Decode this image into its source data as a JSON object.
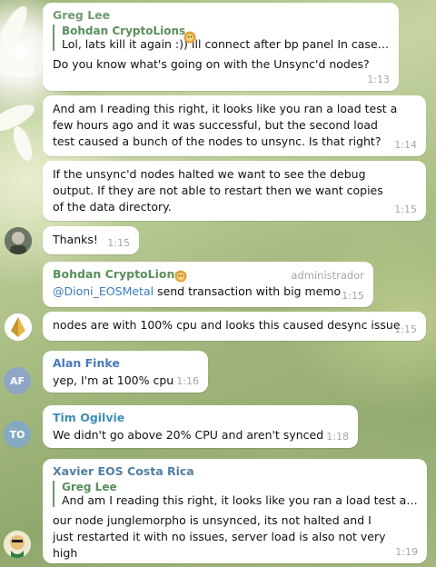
{
  "messages": [
    {
      "author": "Greg Lee",
      "quote_author": "Bohdan CryptoLions",
      "quote_text": "Lol, lats kill it again :)) Ill connect after bp panel In case it ...",
      "text": "Do you know what's going on with the Unsync'd nodes?",
      "time": "1:13"
    },
    {
      "text": "And am I reading this right, it looks like you ran a load test a few hours ago and it was successful, but the second load test caused a bunch of the nodes to unsync.  Is that right?",
      "time": "1:14"
    },
    {
      "text": "If the unsync'd nodes halted we want to see the debug output.  If they are not able to restart then we want copies of the data directory.",
      "time": "1:15"
    },
    {
      "text": "Thanks!",
      "time": "1:15"
    },
    {
      "author": "Bohdan CryptoLions",
      "badge": "administrador",
      "mention": "@Dioni_EOSMetal",
      "text": " send transaction with big memo",
      "time": "1:15"
    },
    {
      "text": "nodes are with 100% cpu and looks this caused desync issue",
      "time": "1:15"
    },
    {
      "author": "Alan Finke",
      "avatar": "AF",
      "text": "yep, I'm at 100% cpu",
      "time": "1:16"
    },
    {
      "author": "Tim Ogilvie",
      "avatar": "TO",
      "text": "We didn't go above 20% CPU and aren't synced",
      "time": "1:18"
    },
    {
      "author": "Xavier EOS Costa Rica",
      "quote_author": "Greg Lee",
      "quote_text": "And am I reading this right, it looks like you ran a load test a fe...",
      "text": "our node junglemorpho is unsynced, its not halted and I just restarted it with no issues, server load is also not very high",
      "time": "1:19"
    }
  ],
  "colors": {
    "greg": "#6f9c6f",
    "bohdan": "#5a8f5b",
    "alan": "#4a79b8",
    "tim": "#3f8fb5",
    "xavier": "#4f7fa3",
    "mention": "#3b7bc2",
    "avatar_af": "#8fa6c6",
    "avatar_to": "#86a9c2"
  }
}
